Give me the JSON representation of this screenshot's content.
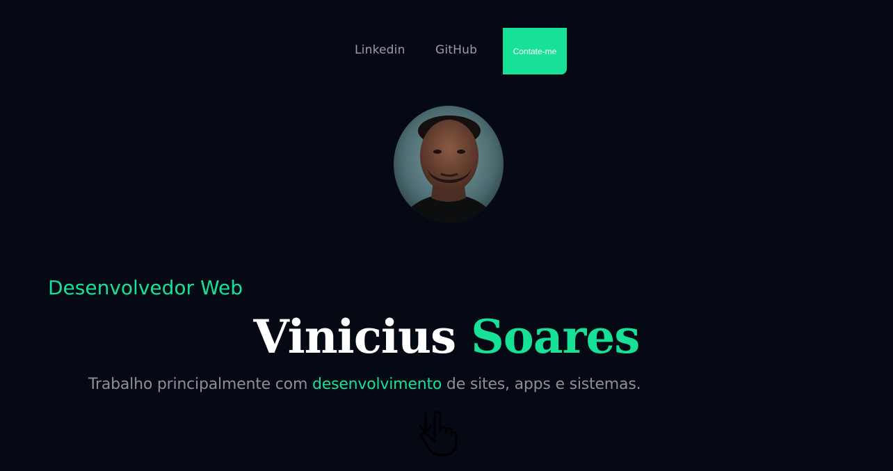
{
  "nav": {
    "linkedin_label": "Linkedin",
    "github_label": "GitHub",
    "contact_label": "Contate-me"
  },
  "hero": {
    "subtitle": "Desenvolvedor Web",
    "name_first": "Vinicius",
    "name_last": "Soares",
    "description_before": "Trabalho principalmente com ",
    "description_highlight": "desenvolvimento",
    "description_after": " de sites, apps e sistemas."
  },
  "icons": {
    "scroll": "pointing-hand-down-icon"
  },
  "colors": {
    "background": "#050913",
    "accent": "#17e197",
    "muted_text": "#8c8f96"
  }
}
